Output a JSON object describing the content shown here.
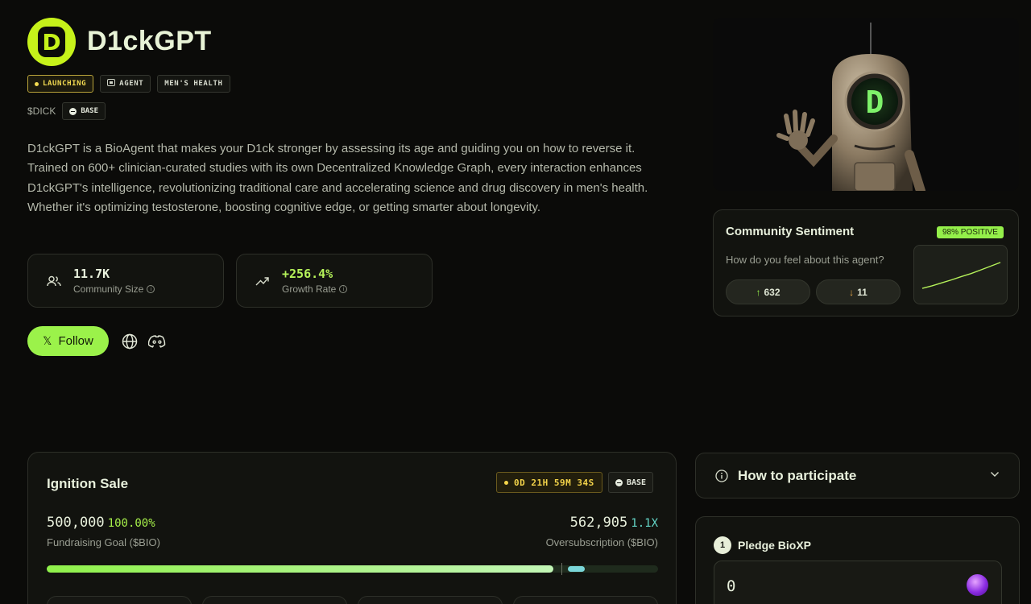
{
  "agent": {
    "name": "D1ckGPT",
    "logo_letter": "D",
    "ticker": "$DICK",
    "chain": "BASE",
    "tags": [
      "LAUNCHING",
      "AGENT",
      "MEN'S HEALTH"
    ],
    "description": "D1ckGPT is a BioAgent that makes your D1ck stronger by assessing its age and guiding you on how to reverse it. Trained on 600+ clinician-curated studies with its own Decentralized Knowledge Graph, every interaction enhances D1ckGPT's intelligence, revolutionizing traditional care and accelerating science and drug discovery in men's health. Whether it's optimizing testosterone, boosting cognitive edge, or getting smarter about longevity."
  },
  "stats": {
    "community_value": "11.7K",
    "community_label": "Community Size",
    "growth_value": "+256.4%",
    "growth_label": "Growth Rate"
  },
  "social": {
    "follow_label": "Follow",
    "follow_icon": "x-logo-icon",
    "icons": [
      "globe-icon",
      "discord-icon"
    ]
  },
  "sentiment": {
    "title": "Community Sentiment",
    "badge": "98% POSITIVE",
    "question": "How do you feel about this agent?",
    "up_count": "632",
    "down_count": "11",
    "trend": [
      0.15,
      0.22,
      0.3,
      0.38,
      0.47,
      0.55,
      0.65,
      0.75,
      0.85
    ],
    "colors": {
      "positive": "#94ef4a"
    }
  },
  "ignition": {
    "title": "Ignition Sale",
    "timer": "0D 21H 59M 34S",
    "chain": "BASE",
    "goal_value": "500,000",
    "goal_pct": "100.00%",
    "goal_label": "Fundraising Goal ($BIO)",
    "over_value": "562,905",
    "over_mult": "1.1X",
    "over_label": "Oversubscription ($BIO)",
    "progress_fraction": 0.876,
    "oversub_fraction": 0.028
  },
  "howto": {
    "title": "How to participate"
  },
  "pledge": {
    "step": "1",
    "title": "Pledge BioXP",
    "value": "0"
  },
  "theme": {
    "accent": "#9bf24a",
    "background": "#0b0b09",
    "launch_yellow": "#f4dc52",
    "teal": "#64d6c8"
  }
}
